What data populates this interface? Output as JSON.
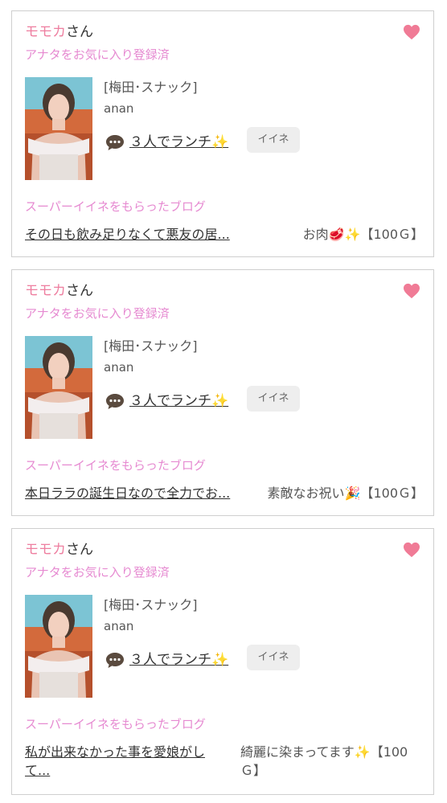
{
  "cards": [
    {
      "name": "モモカ",
      "name_suffix": "さん",
      "favorite_status": "アナタをお気に入り登録済",
      "heart_icon": "heart-icon",
      "shop": "[梅田･スナック]",
      "shop_name": "anan",
      "blog_title": "３人でランチ✨",
      "like_label": "イイネ",
      "section_heading": "スーパーイイネをもらったブログ",
      "entry_title": "その日も飲み足りなくて悪友の居...",
      "gift_text": "お肉",
      "gift_emoji": "🥩✨",
      "gift_price": "【100Ｇ】"
    },
    {
      "name": "モモカ",
      "name_suffix": "さん",
      "favorite_status": "アナタをお気に入り登録済",
      "heart_icon": "heart-icon",
      "shop": "[梅田･スナック]",
      "shop_name": "anan",
      "blog_title": "３人でランチ✨",
      "like_label": "イイネ",
      "section_heading": "スーパーイイネをもらったブログ",
      "entry_title": "本日ララの誕生日なので全力でお...",
      "gift_text": "素敵なお祝い",
      "gift_emoji": "🎉",
      "gift_price": "【100Ｇ】"
    },
    {
      "name": "モモカ",
      "name_suffix": "さん",
      "favorite_status": "アナタをお気に入り登録済",
      "heart_icon": "heart-icon",
      "shop": "[梅田･スナック]",
      "shop_name": "anan",
      "blog_title": "３人でランチ✨",
      "like_label": "イイネ",
      "section_heading": "スーパーイイネをもらったブログ",
      "entry_title_line1": "私が出来なかった事を愛娘がし",
      "entry_title_line2": "て...",
      "gift_text": "綺麗に染まってます✨",
      "gift_price_line1": "【100",
      "gift_price_line2": "Ｇ】"
    }
  ],
  "colors": {
    "accent_pink": "#ee7fa0",
    "heading_pink": "#e68ad1",
    "heart": "#f07b96",
    "border": "#cfcfcf",
    "button_bg": "#eeeeee"
  }
}
